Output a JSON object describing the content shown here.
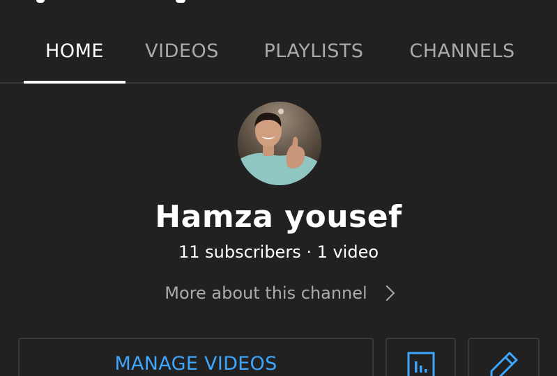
{
  "colors": {
    "background": "#212121",
    "accent": "#3ea6ff",
    "tab_inactive": "#aaaaaa",
    "divider": "#3a3a3a"
  },
  "tabs": [
    {
      "label": "HOME",
      "active": true
    },
    {
      "label": "VIDEOS",
      "active": false
    },
    {
      "label": "PLAYLISTS",
      "active": false
    },
    {
      "label": "CHANNELS",
      "active": false
    }
  ],
  "channel": {
    "name": "Hamza yousef",
    "meta": "11 subscribers · 1 video",
    "more_about": "More about this channel",
    "more_icon": "chevron-right-icon"
  },
  "actions": {
    "manage_videos_label": "MANAGE VIDEOS",
    "analytics_icon": "analytics-icon",
    "edit_icon": "pencil-icon"
  }
}
